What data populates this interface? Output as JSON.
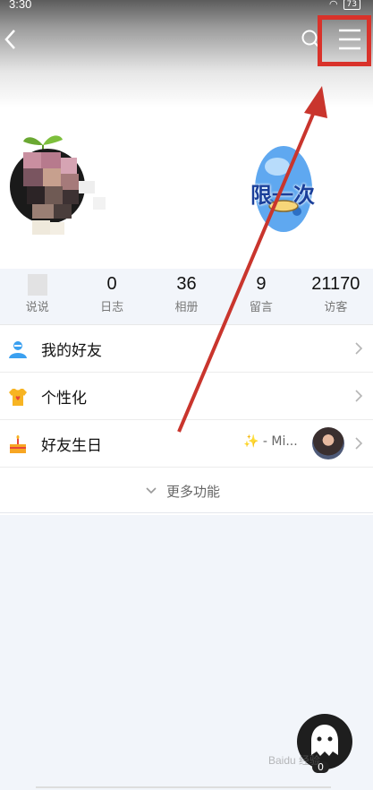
{
  "status_bar": {
    "time": "3:30",
    "battery": "73"
  },
  "header": {
    "back_icon": "chevron-left-icon",
    "search_icon": "search-icon",
    "menu_icon": "hamburger-menu-icon"
  },
  "decoration": {
    "text": "限一次"
  },
  "stats": [
    {
      "value": "",
      "label": "说说"
    },
    {
      "value": "0",
      "label": "日志"
    },
    {
      "value": "36",
      "label": "相册"
    },
    {
      "value": "9",
      "label": "留言"
    },
    {
      "value": "21170",
      "label": "访客"
    }
  ],
  "list": {
    "friends": {
      "label": "我的好友",
      "icon": "person-icon"
    },
    "personalize": {
      "label": "个性化",
      "icon": "shirt-icon"
    },
    "birthday": {
      "label": "好友生日",
      "icon": "cake-icon",
      "extra": "✨ - Mi..."
    },
    "more": {
      "label": "更多功能"
    }
  },
  "float_button": {
    "badge": "0"
  },
  "watermark": "Baidu 经验",
  "colors": {
    "highlight": "#d9322a",
    "accent_blue": "#3aa0f0"
  }
}
